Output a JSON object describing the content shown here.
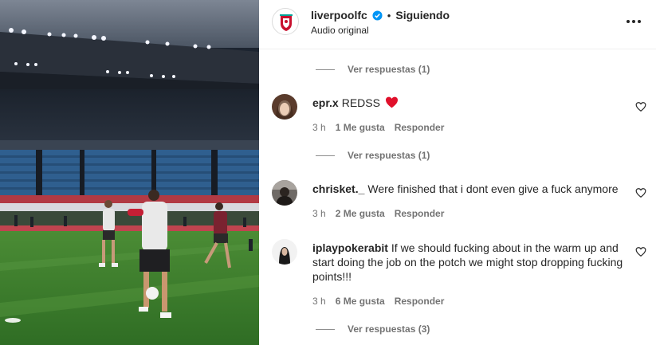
{
  "header": {
    "username": "liverpoolfc",
    "separator": "•",
    "follow_label": "Siguiendo",
    "audio_label": "Audio original",
    "logo_icon": "liverpool-crest-icon",
    "verified_icon": "verified-badge-icon",
    "more_icon": "more-options-icon"
  },
  "replies_toggles": [
    {
      "label": "Ver respuestas (1)"
    },
    {
      "label": "Ver respuestas (1)"
    },
    {
      "label": "Ver respuestas (3)"
    }
  ],
  "comments": [
    {
      "user": "epr.x",
      "text": "REDSS",
      "emoji": "red-heart",
      "time": "3 h",
      "likes": "1 Me gusta",
      "reply": "Responder"
    },
    {
      "user": "chrisket._",
      "text": "Were finished that i dont even give a fuck anymore",
      "time": "3 h",
      "likes": "2 Me gusta",
      "reply": "Responder"
    },
    {
      "user": "iplaypokerabit",
      "text": "If we should fucking about in the warm up and start doing the job on the potch we might stop dropping fucking points!!!",
      "time": "3 h",
      "likes": "6 Me gusta",
      "reply": "Responder"
    }
  ],
  "colors": {
    "verified": "#0095f6",
    "heart": "#ed4956",
    "muted": "#737373",
    "text": "#262626",
    "pitch": "#3f8a2f",
    "stand_seats": "#2f5f8f"
  }
}
